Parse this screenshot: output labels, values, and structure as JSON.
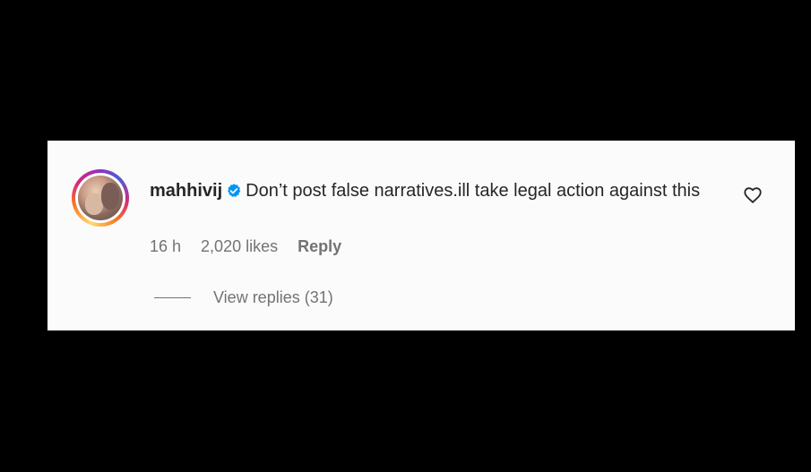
{
  "comment": {
    "username": "mahhivij",
    "verified_icon": "verified-badge-icon",
    "text": "Don’t post false narratives.ill take legal action against this",
    "time": "16 h",
    "likes": "2,020 likes",
    "reply_label": "Reply",
    "view_replies_label": "View replies (31)",
    "like_icon": "heart-outline-icon"
  },
  "colors": {
    "background": "#000000",
    "card": "#fbfbfb",
    "text": "#262626",
    "muted": "#737373",
    "verified": "#0095f6"
  }
}
